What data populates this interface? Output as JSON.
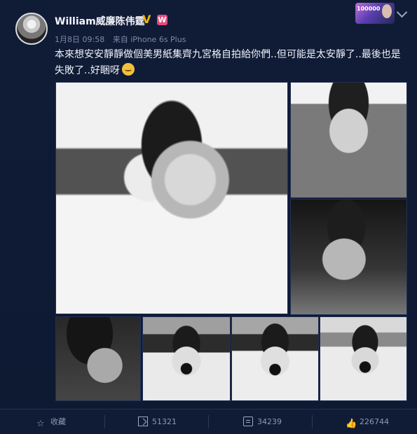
{
  "post": {
    "username": "William威廉陈伟霆",
    "verify_icon": "verified-v-icon",
    "member_icon": "member-w-icon",
    "member_label": "W",
    "time": "1月8日 09:58",
    "source": "来自 iPhone 6s Plus",
    "text": "本來想安安靜靜做個美男紙集齊九宮格自拍給你們..但可能是太安靜了..最後也是失敗了..好睏呀",
    "emoji": "yawn-emoji-icon"
  },
  "top_bar": {
    "thumb_label": "100000"
  },
  "photos": [
    {
      "name": "selfie-1"
    },
    {
      "name": "selfie-2"
    },
    {
      "name": "selfie-3"
    },
    {
      "name": "selfie-4"
    },
    {
      "name": "yawn-1"
    },
    {
      "name": "yawn-2"
    },
    {
      "name": "yawn-3"
    }
  ],
  "actions": {
    "favorite": "收藏",
    "repost_count": "51321",
    "comment_count": "34239",
    "like_count": "226744"
  }
}
